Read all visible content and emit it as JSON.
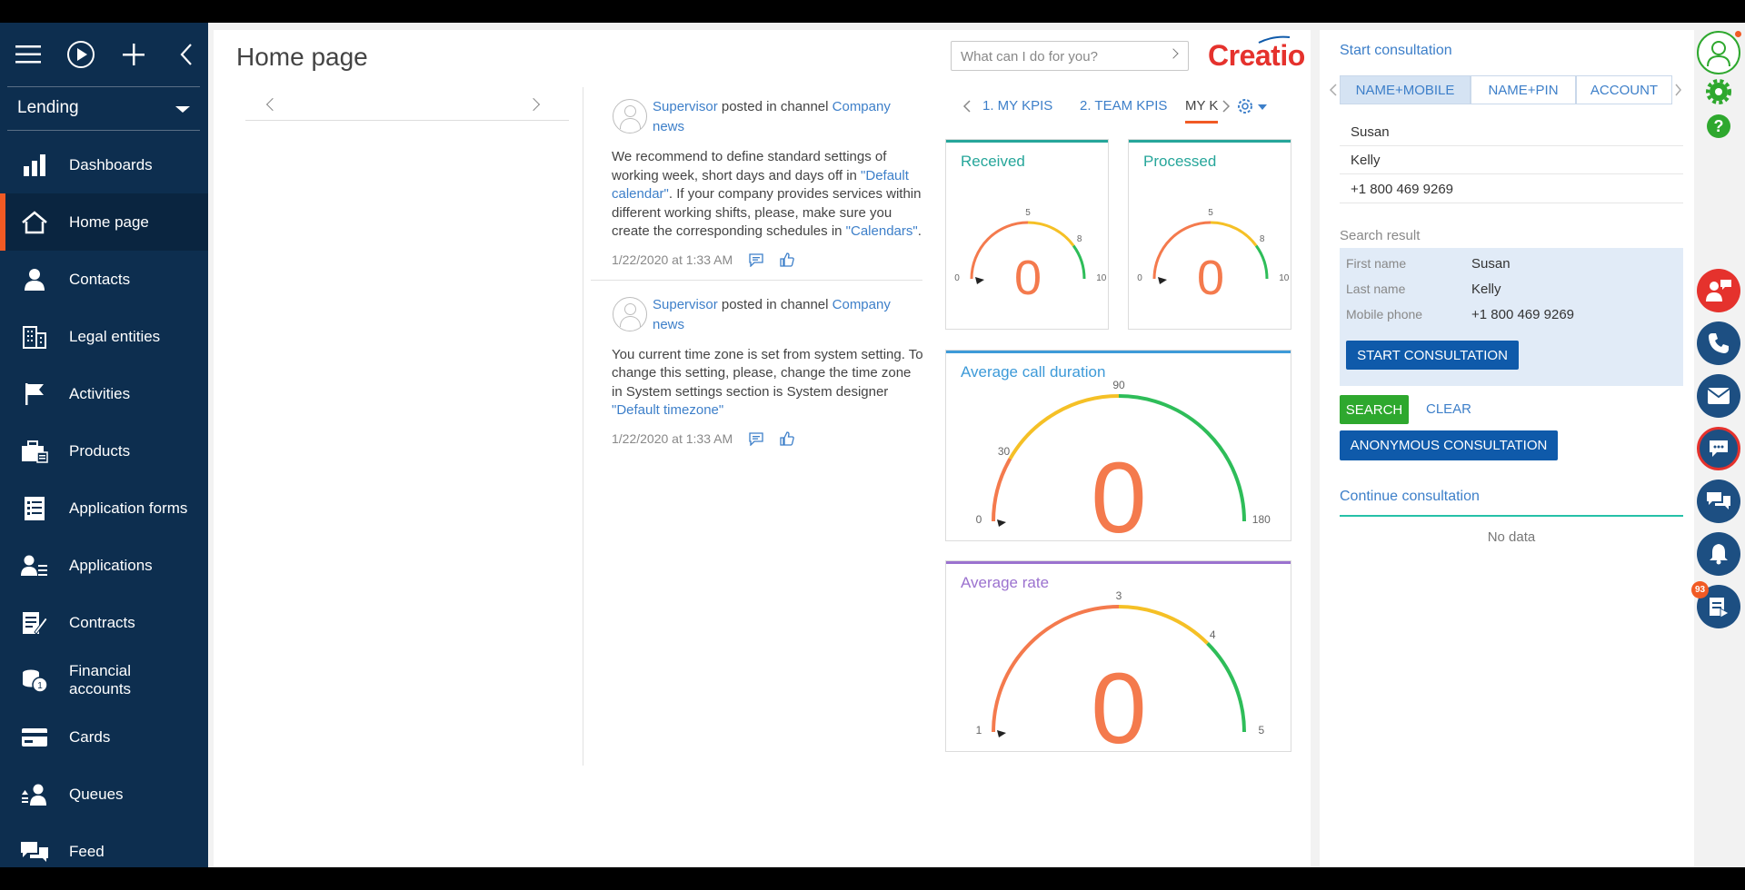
{
  "sidebar": {
    "workspace": "Lending",
    "items": [
      {
        "label": "Dashboards"
      },
      {
        "label": "Home page"
      },
      {
        "label": "Contacts"
      },
      {
        "label": "Legal entities"
      },
      {
        "label": "Activities"
      },
      {
        "label": "Products"
      },
      {
        "label": "Application forms"
      },
      {
        "label": "Applications"
      },
      {
        "label": "Contracts"
      },
      {
        "label": "Financial accounts"
      },
      {
        "label": "Cards"
      },
      {
        "label": "Queues"
      },
      {
        "label": "Feed"
      }
    ]
  },
  "header": {
    "title": "Home page",
    "command_placeholder": "What can I do for you?",
    "logo": "Creatio"
  },
  "feed": {
    "posts": [
      {
        "author": "Supervisor",
        "action": "posted in channel",
        "channel": "Company news",
        "text_1": "We recommend to define standard settings of working week, short days and days off in ",
        "link_1": "\"Default calendar\"",
        "text_2": ". If your company provides services within different working shifts, please, make sure you create the corresponding schedules in ",
        "link_2": "\"Calendars\"",
        "text_3": ".",
        "date": "1/22/2020 at 1:33 AM"
      },
      {
        "author": "Supervisor",
        "action": "posted in channel",
        "channel": "Company news",
        "text_1": "You current time zone is set from system setting. To change this setting, please, change the time zone in System settings section is System designer ",
        "link_1": "\"Default timezone\"",
        "date": "1/22/2020 at 1:33 AM"
      }
    ]
  },
  "kpi": {
    "tabs": [
      "1. MY KPIS",
      "2. TEAM KPIS",
      "MY K"
    ],
    "widgets": [
      {
        "title": "Received",
        "value": "0",
        "ticks": [
          "0",
          "5",
          "8",
          "10"
        ],
        "color": "#26a69a"
      },
      {
        "title": "Processed",
        "value": "0",
        "ticks": [
          "0",
          "5",
          "8",
          "10"
        ],
        "color": "#26a69a"
      },
      {
        "title": "Average call duration",
        "value": "0",
        "ticks": [
          "0",
          "30",
          "90",
          "180"
        ],
        "color": "#3d9ad8"
      },
      {
        "title": "Average rate",
        "value": "0",
        "ticks": [
          "1",
          "3",
          "4",
          "5"
        ],
        "color": "#9b72cf"
      }
    ]
  },
  "consult": {
    "title": "Start consultation",
    "tabs": [
      "NAME+MOBILE",
      "NAME+PIN",
      "ACCOUNT"
    ],
    "fields": [
      "Susan",
      "Kelly",
      "+1 800 469 9269"
    ],
    "search_result_label": "Search result",
    "result": [
      {
        "label": "First name",
        "value": "Susan"
      },
      {
        "label": "Last name",
        "value": "Kelly"
      },
      {
        "label": "Mobile phone",
        "value": "+1 800 469 9269"
      }
    ],
    "start_button": "START CONSULTATION",
    "search_button": "SEARCH",
    "clear_button": "CLEAR",
    "anonymous_button": "ANONYMOUS CONSULTATION",
    "continue_title": "Continue consultation",
    "no_data": "No data"
  },
  "right_column": {
    "notification_count": "93"
  },
  "colors": {
    "sidebar": "#0d2e4f",
    "accent": "#f15a24",
    "link": "#3d7fc9",
    "button_blue": "#0f5aaa",
    "button_green": "#2ea82e"
  }
}
